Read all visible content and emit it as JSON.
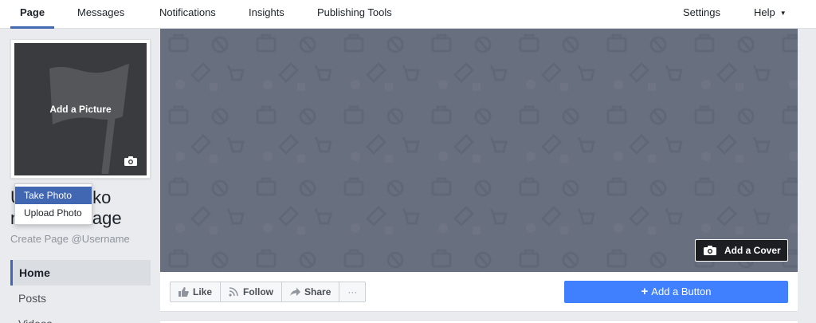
{
  "topnav": {
    "items": [
      {
        "label": "Page",
        "active": true
      },
      {
        "label": "Messages"
      },
      {
        "label": "Notifications"
      },
      {
        "label": "Insights"
      },
      {
        "label": "Publishing Tools"
      },
      {
        "label": "Settings"
      },
      {
        "label": "Help"
      }
    ]
  },
  "profile": {
    "add_picture_label": "Add a Picture",
    "page_name_line1": "U",
    "page_name_line1_end": "kako",
    "page_name_line2": "n",
    "page_name_line2_end": "Page",
    "username_link": "Create Page @Username"
  },
  "photo_menu": {
    "items": [
      "Take Photo",
      "Upload Photo"
    ]
  },
  "sidenav": {
    "items": [
      "Home",
      "Posts",
      "Videos"
    ]
  },
  "cover": {
    "add_cover_label": "Add a Cover"
  },
  "actions": {
    "like": "Like",
    "follow": "Follow",
    "share": "Share",
    "more": "···",
    "add_button": "Add a Button",
    "add_button_plus": "+"
  },
  "colors": {
    "accent": "#4267b2",
    "primary_button": "#4080ff",
    "cover_bg": "#686f7f"
  }
}
